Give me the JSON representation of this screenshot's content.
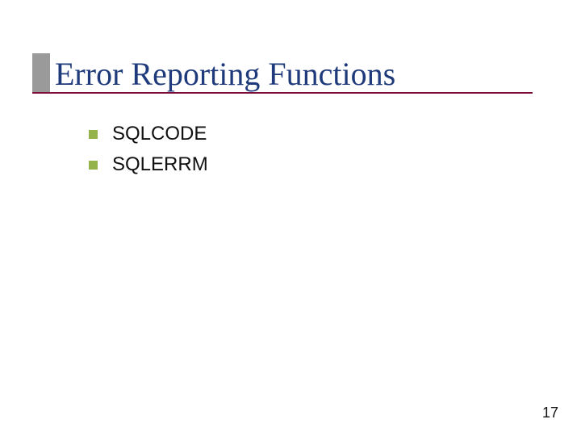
{
  "title": "Error Reporting Functions",
  "bullets": [
    {
      "text": "SQLCODE"
    },
    {
      "text": "SQLERRM"
    }
  ],
  "page_number": "17",
  "colors": {
    "title": "#1e3a7b",
    "rule": "#7b0f3a",
    "tick": "#9a9a9a",
    "bullet": "#94b34a"
  }
}
